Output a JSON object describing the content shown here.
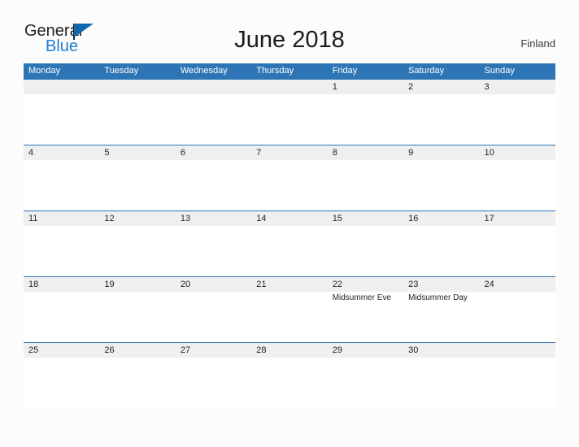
{
  "logo": {
    "word_one": "General",
    "word_two": "Blue",
    "flag_icon": "blue-triangle-flag-icon",
    "color_dark": "#231f20",
    "color_blue": "#1f7fd0"
  },
  "header": {
    "title": "June 2018",
    "country": "Finland"
  },
  "theme": {
    "header_blue": "#2e75b6",
    "date_band_gray": "#efefef",
    "page_background": "#fcfcfc",
    "text_dark": "#231f20"
  },
  "calendar": {
    "weekdays": [
      "Monday",
      "Tuesday",
      "Wednesday",
      "Thursday",
      "Friday",
      "Saturday",
      "Sunday"
    ],
    "weeks": [
      [
        {
          "date": "",
          "event": ""
        },
        {
          "date": "",
          "event": ""
        },
        {
          "date": "",
          "event": ""
        },
        {
          "date": "",
          "event": ""
        },
        {
          "date": "1",
          "event": ""
        },
        {
          "date": "2",
          "event": ""
        },
        {
          "date": "3",
          "event": ""
        }
      ],
      [
        {
          "date": "4",
          "event": ""
        },
        {
          "date": "5",
          "event": ""
        },
        {
          "date": "6",
          "event": ""
        },
        {
          "date": "7",
          "event": ""
        },
        {
          "date": "8",
          "event": ""
        },
        {
          "date": "9",
          "event": ""
        },
        {
          "date": "10",
          "event": ""
        }
      ],
      [
        {
          "date": "11",
          "event": ""
        },
        {
          "date": "12",
          "event": ""
        },
        {
          "date": "13",
          "event": ""
        },
        {
          "date": "14",
          "event": ""
        },
        {
          "date": "15",
          "event": ""
        },
        {
          "date": "16",
          "event": ""
        },
        {
          "date": "17",
          "event": ""
        }
      ],
      [
        {
          "date": "18",
          "event": ""
        },
        {
          "date": "19",
          "event": ""
        },
        {
          "date": "20",
          "event": ""
        },
        {
          "date": "21",
          "event": ""
        },
        {
          "date": "22",
          "event": "Midsummer Eve"
        },
        {
          "date": "23",
          "event": "Midsummer Day"
        },
        {
          "date": "24",
          "event": ""
        }
      ],
      [
        {
          "date": "25",
          "event": ""
        },
        {
          "date": "26",
          "event": ""
        },
        {
          "date": "27",
          "event": ""
        },
        {
          "date": "28",
          "event": ""
        },
        {
          "date": "29",
          "event": ""
        },
        {
          "date": "30",
          "event": ""
        },
        {
          "date": "",
          "event": ""
        }
      ]
    ]
  }
}
